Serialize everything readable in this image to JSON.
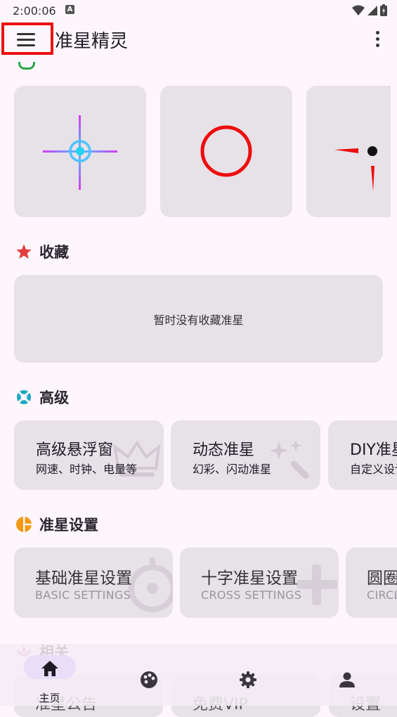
{
  "status_bar": {
    "time": "2:00:06",
    "notif_letter": "A"
  },
  "app_bar": {
    "title": "准星精灵"
  },
  "favorites": {
    "title": "收藏",
    "empty_text": "暂时没有收藏准星"
  },
  "advanced": {
    "title": "高级",
    "items": [
      {
        "title": "高级悬浮窗",
        "subtitle": "网速、时钟、电量等"
      },
      {
        "title": "动态准星",
        "subtitle": "幻彩、闪动准星"
      },
      {
        "title": "DIY准星",
        "subtitle": "自定义设计"
      }
    ]
  },
  "crosshair_settings": {
    "title": "准星设置",
    "items": [
      {
        "title": "基础准星设置",
        "subtitle": "BASIC SETTINGS"
      },
      {
        "title": "十字准星设置",
        "subtitle": "CROSS SETTINGS"
      },
      {
        "title": "圆圈准星设置",
        "subtitle": "CIRCLE SETTINGS"
      }
    ]
  },
  "related": {
    "title": "相关",
    "items": [
      {
        "label": "准星公告"
      },
      {
        "label": "免费VIP"
      },
      {
        "label": "设置"
      }
    ]
  },
  "bottom_nav": {
    "items": [
      {
        "label": "主页",
        "icon": "home-icon",
        "active": true
      },
      {
        "label": "",
        "icon": "palette-icon"
      },
      {
        "label": "",
        "icon": "gear-icon"
      },
      {
        "label": "",
        "icon": "person-icon"
      }
    ]
  },
  "colors": {
    "highlight_border": "#ec1111",
    "card_bg": "#e7e1e8",
    "page_bg": "#fdf7fd",
    "favorite_star": "#e24040",
    "advanced_icon": "#1aa8c4",
    "settings_icon": "#f39a12"
  }
}
